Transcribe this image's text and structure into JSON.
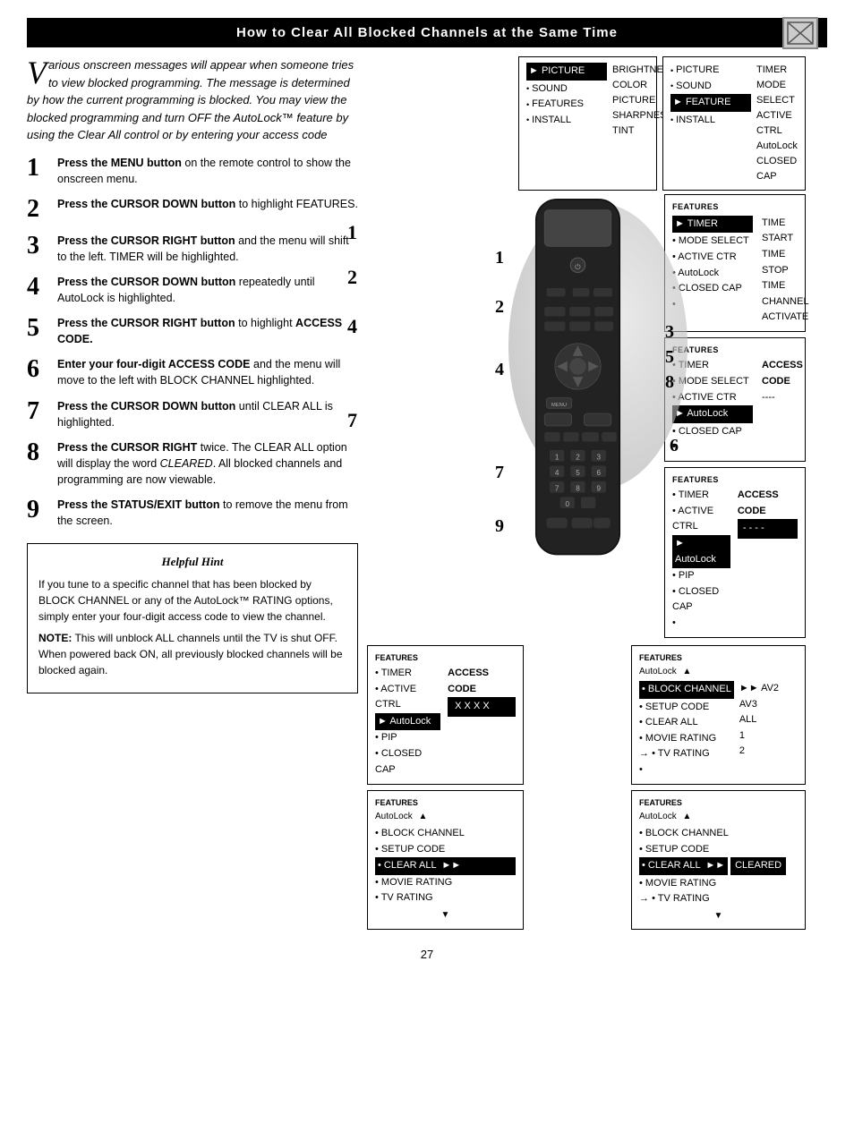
{
  "header": {
    "title": "How to Clear All Blocked Channels at the Same Time"
  },
  "intro": {
    "drop_cap": "V",
    "text": "arious onscreen messages will appear when someone tries to view blocked programming. The message is determined by how the current programming is blocked. You may view the blocked programming and turn OFF the AutoLock™ feature by using the Clear All control or by entering your access code"
  },
  "steps": [
    {
      "number": "1",
      "text_parts": [
        {
          "bold": true,
          "text": "Press the MENU button"
        },
        {
          "bold": false,
          "text": " on the remote control to show the onscreen menu."
        }
      ]
    },
    {
      "number": "2",
      "text_parts": [
        {
          "bold": true,
          "text": "Press the CURSOR DOWN button"
        },
        {
          "bold": false,
          "text": " to highlight FEATURES."
        }
      ]
    },
    {
      "number": "3",
      "text_parts": [
        {
          "bold": true,
          "text": "Press the CURSOR RIGHT button"
        },
        {
          "bold": false,
          "text": " and the menu will shift to the left. TIMER will be highlighted."
        }
      ]
    },
    {
      "number": "4",
      "text_parts": [
        {
          "bold": true,
          "text": "Press the CURSOR DOWN button"
        },
        {
          "bold": false,
          "text": " repeatedly until AutoLock is highlighted."
        }
      ]
    },
    {
      "number": "5",
      "text_parts": [
        {
          "bold": true,
          "text": "Press the CURSOR RIGHT button"
        },
        {
          "bold": false,
          "text": " to highlight "
        },
        {
          "bold": true,
          "text": "ACCESS CODE."
        }
      ]
    },
    {
      "number": "6",
      "text_parts": [
        {
          "bold": true,
          "text": "Enter your four-digit ACCESS CODE"
        },
        {
          "bold": false,
          "text": " and the menu will move to the left with BLOCK CHANNEL highlighted."
        }
      ]
    },
    {
      "number": "7",
      "text_parts": [
        {
          "bold": true,
          "text": "Press the CURSOR DOWN button"
        },
        {
          "bold": false,
          "text": " until CLEAR ALL is highlighted."
        }
      ]
    },
    {
      "number": "8",
      "text_parts": [
        {
          "bold": true,
          "text": "Press the CURSOR RIGHT"
        },
        {
          "bold": false,
          "text": " twice. The CLEAR ALL option will display the word "
        },
        {
          "bold": false,
          "italic": true,
          "text": "CLEARED"
        },
        {
          "bold": false,
          "text": ". All blocked channels and programming are now viewable."
        }
      ]
    },
    {
      "number": "9",
      "text_parts": [
        {
          "bold": true,
          "text": "Press the STATUS/EXIT button"
        },
        {
          "bold": false,
          "text": " to remove the menu from the screen."
        }
      ]
    }
  ],
  "helpful_hint": {
    "title": "Helpful Hint",
    "body": "If you tune to a specific channel that has been blocked by BLOCK CHANNEL or any of the AutoLock™ RATING options, simply enter your four-digit access code to view the channel.",
    "note": "NOTE: This will unblock ALL channels until the TV is shut OFF. When powered back ON, all previously blocked channels will be blocked again."
  },
  "panel1": {
    "title": "PICTURE",
    "items": [
      "SOUND",
      "FEATURES",
      "INSTALL"
    ],
    "right": [
      "BRIGHTNESS",
      "COLOR",
      "PICTURE",
      "SHARPNESS",
      "TINT"
    ],
    "selected": "PICTURE"
  },
  "panel2": {
    "title": "",
    "items": [
      "PICTURE",
      "SOUND",
      "FEATURE",
      "INSTALL"
    ],
    "right": [
      "TIMER",
      "MODE SELECT",
      "ACTIVE CTRL",
      "AutoLock",
      "CLOSED CAP"
    ],
    "selected": "FEATURE"
  },
  "panel3": {
    "title": "FEATURES",
    "header_selected": "TIMER",
    "items": [
      "MODE SELECT",
      "ACTIVE CTR",
      "AutoLock",
      "CLOSED CAP",
      ""
    ],
    "right": [
      "TIME",
      "START TIME",
      "STOP TIME",
      "CHANNEL",
      "ACTIVATE"
    ]
  },
  "panel4": {
    "title": "FEATURES",
    "items": [
      "TIMER",
      "MODE SELECT",
      "ACTIVE CTR",
      "AutoLock",
      "CLOSED CAP",
      ""
    ],
    "selected": "AutoLock",
    "right_label": "ACCESS CODE",
    "right_value": "----"
  },
  "panel5": {
    "title": "FEATURES",
    "items": [
      "TIMER",
      "ACTIVE CTRL",
      "AutoLock",
      "PIP",
      "CLOSED CAP",
      ""
    ],
    "right_label": "ACCESS CODE",
    "right_value": "- - - -"
  },
  "panel6": {
    "title": "FEATURES",
    "sub": "AutoLock",
    "items": [
      "BLOCK CHANNEL",
      "SETUP CODE",
      "CLEAR ALL",
      "MOVIE RATING",
      "TV RATING",
      ""
    ],
    "selected": "BLOCK CHANNEL",
    "right": [
      "AV2",
      "AV3",
      "ALL",
      "1",
      "2"
    ]
  },
  "panel7_left": {
    "title": "FEATURES",
    "sub": "AutoLock",
    "items": [
      "BLOCK CHANNEL",
      "SETUP CODE",
      "CLEAR ALL",
      "MOVIE RATING",
      "TV RATING"
    ],
    "selected": "CLEAR ALL",
    "code": "X X X X"
  },
  "panel7_right": {
    "title": "FEATURES",
    "sub": "AutoLock",
    "items": [
      "BLOCK CHANNEL",
      "SETUP CODE",
      "CLEAR ALL",
      "MOVIE RATING",
      "TV RATING"
    ],
    "selected": "CLEAR ALL",
    "cleared": "CLEARED"
  },
  "page_number": "27",
  "step_overlays": [
    "1",
    "2",
    "4",
    "7",
    "3\n5\n8",
    "6",
    "9"
  ]
}
